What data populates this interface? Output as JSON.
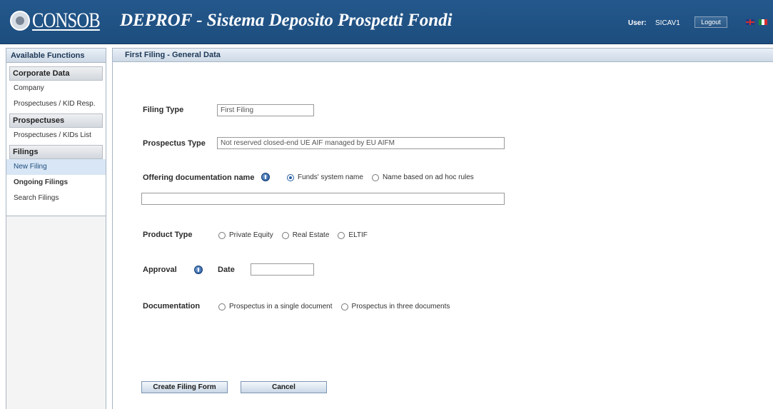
{
  "header": {
    "logo_text": "CONSOB",
    "title": "DEPROF - Sistema Deposito Prospetti Fondi",
    "user_label": "User:",
    "user_value": "SICAV1",
    "logout_label": "Logout",
    "languages": [
      "en-flag-icon",
      "it-flag-icon"
    ]
  },
  "sidebar": {
    "title": "Available Functions",
    "sections": [
      {
        "label": "Corporate Data",
        "items": [
          {
            "label": "Company"
          },
          {
            "label": "Prospectuses / KID Resp."
          }
        ]
      },
      {
        "label": "Prospectuses",
        "items": [
          {
            "label": "Prospectuses / KIDs List"
          }
        ]
      },
      {
        "label": "Filings",
        "items": [
          {
            "label": "New Filing",
            "active": true
          },
          {
            "label": "Ongoing Filings",
            "bold": true
          },
          {
            "label": "Search Filings"
          }
        ]
      }
    ]
  },
  "main": {
    "title": "First Filing - General Data",
    "filing_type": {
      "label": "Filing Type",
      "value": "First Filing"
    },
    "prospectus_type": {
      "label": "Prospectus Type",
      "value": "Not reserved closed-end UE AIF managed by EU AIFM"
    },
    "offering_doc": {
      "label": "Offering documentation name",
      "options": [
        "Funds' system name",
        "Name based on ad hoc rules"
      ],
      "selected": "Funds' system name",
      "name_value": ""
    },
    "product_type": {
      "label": "Product Type",
      "options": [
        "Private Equity",
        "Real Estate",
        "ELTIF"
      ],
      "selected": null
    },
    "approval": {
      "label": "Approval",
      "date_label": "Date",
      "date_value": ""
    },
    "documentation": {
      "label": "Documentation",
      "options": [
        "Prospectus in a single document",
        "Prospectus in three documents"
      ],
      "selected": null
    },
    "buttons": {
      "create": "Create Filing Form",
      "cancel": "Cancel"
    }
  },
  "colors": {
    "header_bg": "#1d4d7e",
    "panel_head_bg": "#cdd9e6",
    "active_item_bg": "#d8e6f5"
  }
}
